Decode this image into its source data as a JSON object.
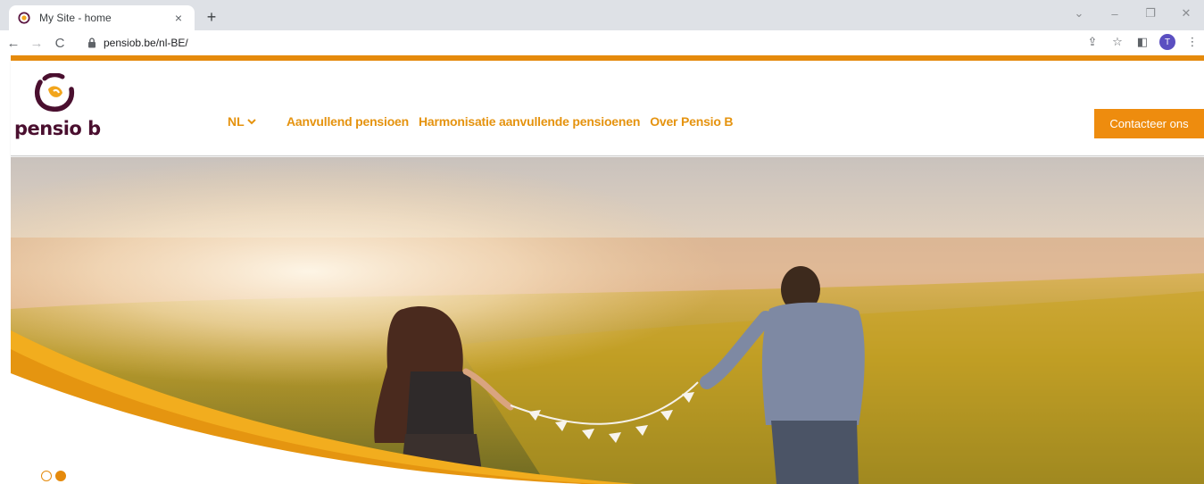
{
  "browser": {
    "tab_title": "My Site - home",
    "tab_close": "×",
    "new_tab": "+",
    "url": "pensiob.be/nl-BE/",
    "profile_initial": "T",
    "controls": {
      "dropdown": "⌄",
      "minimize": "–",
      "restore": "❐",
      "close": "✕"
    },
    "nav": {
      "back": "←",
      "forward": "→",
      "reload": "C"
    },
    "toolbar_icons": {
      "share": "⇪",
      "bookmark": "☆",
      "sidepanel": "◧",
      "menu": "⋮"
    }
  },
  "site": {
    "logo_text": "pensio b",
    "language": "NL",
    "language_chevron": "⌄",
    "nav": [
      "Aanvullend pensioen",
      "Harmonisatie aanvullende pensioenen",
      "Over Pensio B"
    ],
    "cta_label": "Contacteer ons",
    "colors": {
      "accent": "#e58a0c",
      "brand_dark": "#4a0f2f",
      "swoosh": "#f0a81e"
    },
    "slider": {
      "slide_count": 2,
      "active_index": 1
    }
  }
}
